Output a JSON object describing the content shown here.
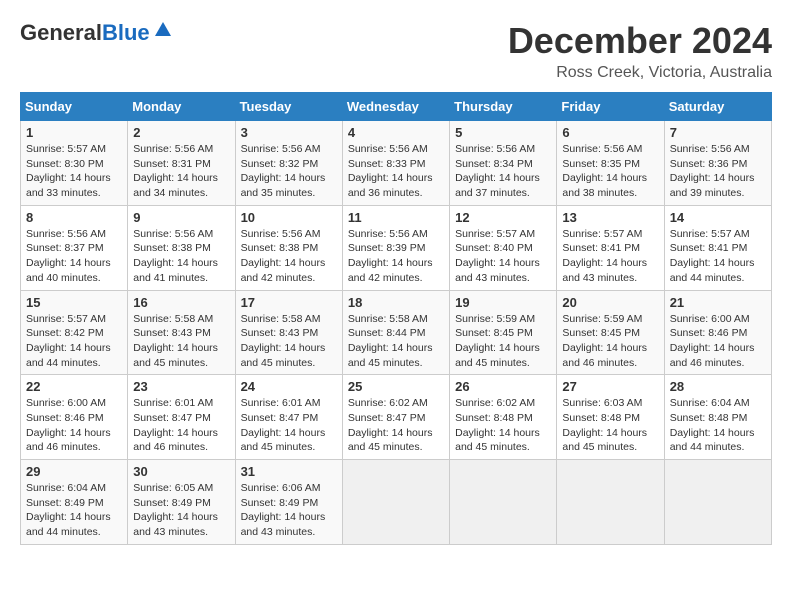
{
  "logo": {
    "general": "General",
    "blue": "Blue"
  },
  "title": "December 2024",
  "location": "Ross Creek, Victoria, Australia",
  "days_header": [
    "Sunday",
    "Monday",
    "Tuesday",
    "Wednesday",
    "Thursday",
    "Friday",
    "Saturday"
  ],
  "weeks": [
    [
      {
        "day": "1",
        "info": "Sunrise: 5:57 AM\nSunset: 8:30 PM\nDaylight: 14 hours and 33 minutes."
      },
      {
        "day": "2",
        "info": "Sunrise: 5:56 AM\nSunset: 8:31 PM\nDaylight: 14 hours and 34 minutes."
      },
      {
        "day": "3",
        "info": "Sunrise: 5:56 AM\nSunset: 8:32 PM\nDaylight: 14 hours and 35 minutes."
      },
      {
        "day": "4",
        "info": "Sunrise: 5:56 AM\nSunset: 8:33 PM\nDaylight: 14 hours and 36 minutes."
      },
      {
        "day": "5",
        "info": "Sunrise: 5:56 AM\nSunset: 8:34 PM\nDaylight: 14 hours and 37 minutes."
      },
      {
        "day": "6",
        "info": "Sunrise: 5:56 AM\nSunset: 8:35 PM\nDaylight: 14 hours and 38 minutes."
      },
      {
        "day": "7",
        "info": "Sunrise: 5:56 AM\nSunset: 8:36 PM\nDaylight: 14 hours and 39 minutes."
      }
    ],
    [
      {
        "day": "8",
        "info": "Sunrise: 5:56 AM\nSunset: 8:37 PM\nDaylight: 14 hours and 40 minutes."
      },
      {
        "day": "9",
        "info": "Sunrise: 5:56 AM\nSunset: 8:38 PM\nDaylight: 14 hours and 41 minutes."
      },
      {
        "day": "10",
        "info": "Sunrise: 5:56 AM\nSunset: 8:38 PM\nDaylight: 14 hours and 42 minutes."
      },
      {
        "day": "11",
        "info": "Sunrise: 5:56 AM\nSunset: 8:39 PM\nDaylight: 14 hours and 42 minutes."
      },
      {
        "day": "12",
        "info": "Sunrise: 5:57 AM\nSunset: 8:40 PM\nDaylight: 14 hours and 43 minutes."
      },
      {
        "day": "13",
        "info": "Sunrise: 5:57 AM\nSunset: 8:41 PM\nDaylight: 14 hours and 43 minutes."
      },
      {
        "day": "14",
        "info": "Sunrise: 5:57 AM\nSunset: 8:41 PM\nDaylight: 14 hours and 44 minutes."
      }
    ],
    [
      {
        "day": "15",
        "info": "Sunrise: 5:57 AM\nSunset: 8:42 PM\nDaylight: 14 hours and 44 minutes."
      },
      {
        "day": "16",
        "info": "Sunrise: 5:58 AM\nSunset: 8:43 PM\nDaylight: 14 hours and 45 minutes."
      },
      {
        "day": "17",
        "info": "Sunrise: 5:58 AM\nSunset: 8:43 PM\nDaylight: 14 hours and 45 minutes."
      },
      {
        "day": "18",
        "info": "Sunrise: 5:58 AM\nSunset: 8:44 PM\nDaylight: 14 hours and 45 minutes."
      },
      {
        "day": "19",
        "info": "Sunrise: 5:59 AM\nSunset: 8:45 PM\nDaylight: 14 hours and 45 minutes."
      },
      {
        "day": "20",
        "info": "Sunrise: 5:59 AM\nSunset: 8:45 PM\nDaylight: 14 hours and 46 minutes."
      },
      {
        "day": "21",
        "info": "Sunrise: 6:00 AM\nSunset: 8:46 PM\nDaylight: 14 hours and 46 minutes."
      }
    ],
    [
      {
        "day": "22",
        "info": "Sunrise: 6:00 AM\nSunset: 8:46 PM\nDaylight: 14 hours and 46 minutes."
      },
      {
        "day": "23",
        "info": "Sunrise: 6:01 AM\nSunset: 8:47 PM\nDaylight: 14 hours and 46 minutes."
      },
      {
        "day": "24",
        "info": "Sunrise: 6:01 AM\nSunset: 8:47 PM\nDaylight: 14 hours and 45 minutes."
      },
      {
        "day": "25",
        "info": "Sunrise: 6:02 AM\nSunset: 8:47 PM\nDaylight: 14 hours and 45 minutes."
      },
      {
        "day": "26",
        "info": "Sunrise: 6:02 AM\nSunset: 8:48 PM\nDaylight: 14 hours and 45 minutes."
      },
      {
        "day": "27",
        "info": "Sunrise: 6:03 AM\nSunset: 8:48 PM\nDaylight: 14 hours and 45 minutes."
      },
      {
        "day": "28",
        "info": "Sunrise: 6:04 AM\nSunset: 8:48 PM\nDaylight: 14 hours and 44 minutes."
      }
    ],
    [
      {
        "day": "29",
        "info": "Sunrise: 6:04 AM\nSunset: 8:49 PM\nDaylight: 14 hours and 44 minutes."
      },
      {
        "day": "30",
        "info": "Sunrise: 6:05 AM\nSunset: 8:49 PM\nDaylight: 14 hours and 43 minutes."
      },
      {
        "day": "31",
        "info": "Sunrise: 6:06 AM\nSunset: 8:49 PM\nDaylight: 14 hours and 43 minutes."
      },
      {
        "day": "",
        "info": ""
      },
      {
        "day": "",
        "info": ""
      },
      {
        "day": "",
        "info": ""
      },
      {
        "day": "",
        "info": ""
      }
    ]
  ]
}
